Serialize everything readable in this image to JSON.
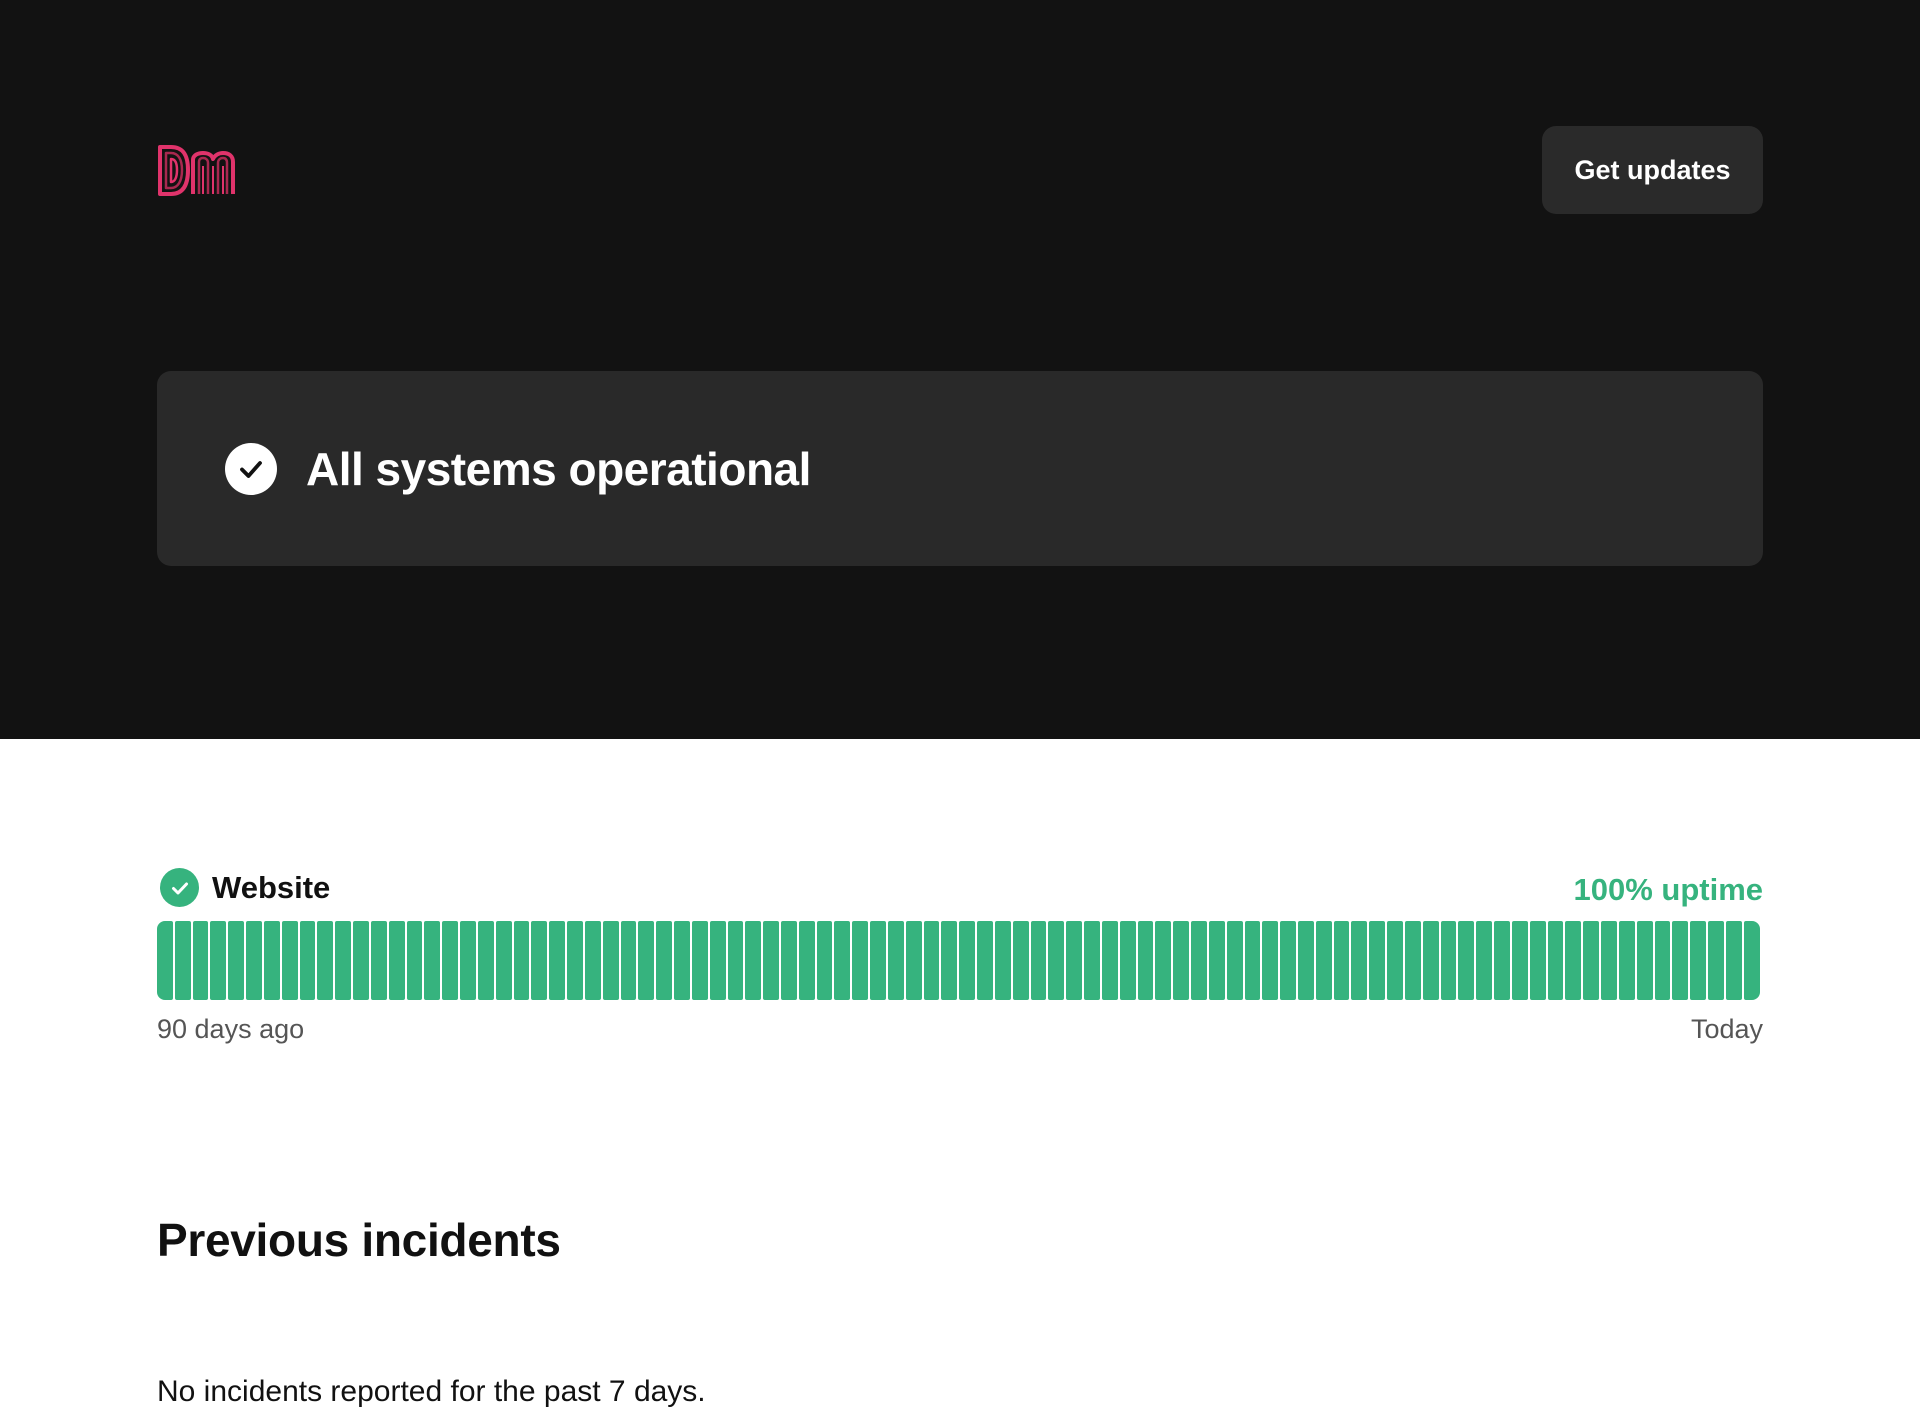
{
  "header": {
    "logo_text": "DM",
    "get_updates_label": "Get updates"
  },
  "status_banner": {
    "text": "All systems operational",
    "icon": "check-circle-icon"
  },
  "components": [
    {
      "name": "Website",
      "icon": "check-circle-icon",
      "uptime_label": "100% uptime",
      "uptime_percent": 100,
      "days_shown": 90,
      "range_start": "90 days ago",
      "range_end": "Today"
    }
  ],
  "incidents": {
    "title": "Previous incidents",
    "empty_message": "No incidents reported for the past 7 days."
  },
  "colors": {
    "hero_bg": "#121212",
    "banner_bg": "#292929",
    "button_bg": "#2a2a2a",
    "operational_green": "#36b37e",
    "logo_pink": "#e0336b"
  }
}
